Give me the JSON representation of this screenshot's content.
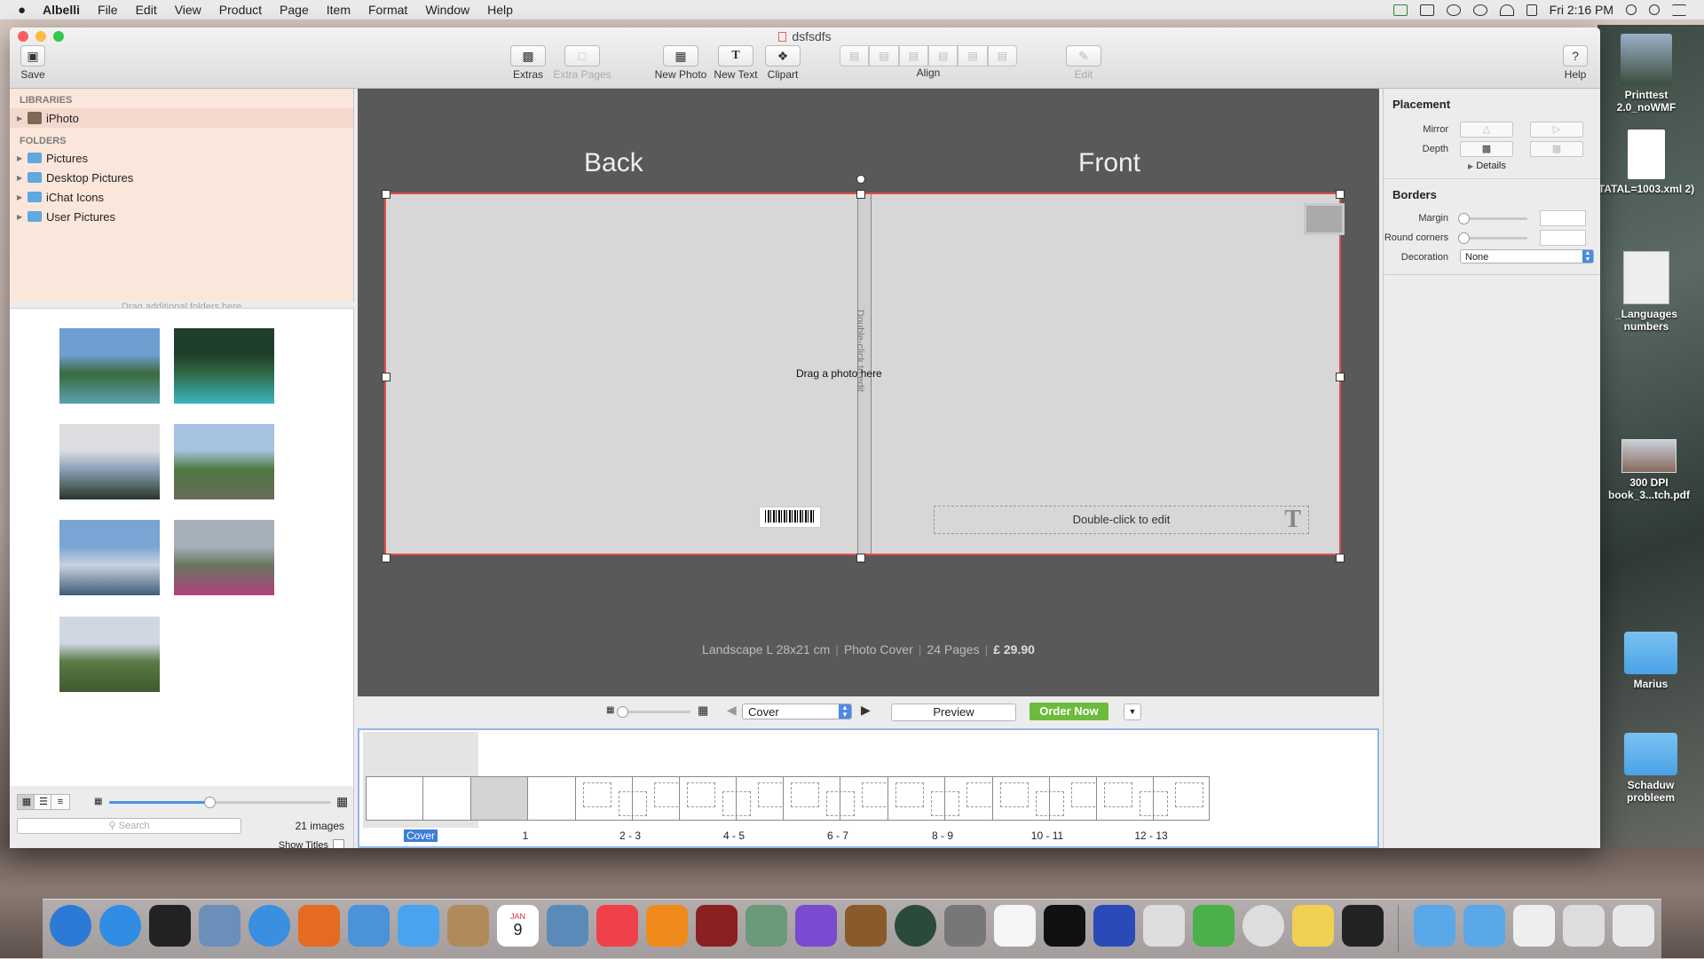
{
  "menubar": {
    "apple": "",
    "app_name": "Albelli",
    "menus": [
      "File",
      "Edit",
      "View",
      "Product",
      "Page",
      "Item",
      "Format",
      "Window",
      "Help"
    ],
    "clock": "Fri 2:16 PM"
  },
  "window": {
    "title": "dsfsdfs",
    "toolbar": {
      "save": "Save",
      "extras": "Extras",
      "extra_pages": "Extra Pages",
      "new_photo": "New Photo",
      "new_text": "New Text",
      "clipart": "Clipart",
      "align": "Align",
      "edit": "Edit",
      "help": "Help"
    }
  },
  "sidebar": {
    "libraries_header": "LIBRARIES",
    "libraries": [
      {
        "label": "iPhoto"
      }
    ],
    "folders_header": "FOLDERS",
    "folders": [
      {
        "label": "Pictures"
      },
      {
        "label": "Desktop Pictures"
      },
      {
        "label": "iChat Icons"
      },
      {
        "label": "User Pictures"
      }
    ],
    "drag_hint": "Drag additional folders here"
  },
  "library": {
    "thumbnails": [
      {
        "name": "mountain-lake",
        "colors": [
          "#6f9fd1",
          "#3a6a3c",
          "#5aa0b0"
        ]
      },
      {
        "name": "pine-forest-lake",
        "colors": [
          "#1f3f2a",
          "#2e6a44",
          "#3ab6c2"
        ]
      },
      {
        "name": "cloudy-shore",
        "colors": [
          "#dcdde0",
          "#8aa0b8",
          "#2a3528"
        ]
      },
      {
        "name": "green-path",
        "colors": [
          "#a7c2e0",
          "#4d7a40",
          "#6a6a5a"
        ]
      },
      {
        "name": "sky-lake",
        "colors": [
          "#7aa4d4",
          "#c7d3df",
          "#3f5c7a"
        ]
      },
      {
        "name": "purple-flowers",
        "colors": [
          "#a5b0ba",
          "#6a7560",
          "#b0407a"
        ]
      },
      {
        "name": "green-valley",
        "colors": [
          "#cfd8e2",
          "#5a7a45",
          "#3f5a30"
        ]
      }
    ],
    "search_placeholder": "Search",
    "image_count": "21 images",
    "show_titles": "Show Titles"
  },
  "canvas": {
    "back_label": "Back",
    "front_label": "Front",
    "drag_photo_hint": "Drag a photo here",
    "spine_hint": "Double-click to edit",
    "text_box_hint": "Double-click to edit",
    "info": {
      "format": "Landscape L 28x21 cm",
      "cover": "Photo Cover",
      "pages": "24 Pages",
      "price": "£ 29.90"
    }
  },
  "controls": {
    "page_select": "Cover",
    "preview": "Preview",
    "order_now": "Order Now"
  },
  "filmstrip": [
    {
      "label": "Cover"
    },
    {
      "label": "1"
    },
    {
      "label": "2 - 3"
    },
    {
      "label": "4 - 5"
    },
    {
      "label": "6 - 7"
    },
    {
      "label": "8 - 9"
    },
    {
      "label": "10 - 11"
    },
    {
      "label": "12 - 13"
    }
  ],
  "inspector": {
    "placement_header": "Placement",
    "mirror": "Mirror",
    "depth": "Depth",
    "details": "Details",
    "borders_header": "Borders",
    "margin": "Margin",
    "round_corners": "Round corners",
    "decoration": "Decoration",
    "decoration_value": "None"
  },
  "desktop": {
    "icons": [
      {
        "label": "Printtest 2.0_noWMF"
      },
      {
        "label": "TATAL=1003.xml 2)"
      },
      {
        "label": "_Languages numbers"
      },
      {
        "label": "300 DPI book_3...tch.pdf"
      },
      {
        "label": "Marius"
      },
      {
        "label": "Schaduw probleem"
      }
    ]
  },
  "dock": {
    "apps": [
      "finder-icon",
      "app-store-icon",
      "launchpad-icon",
      "preview-icon",
      "safari-icon",
      "firefox-icon",
      "mail-icon",
      "messages-icon",
      "contacts-icon",
      "calendar-icon",
      "iphoto-icon",
      "itunes-icon",
      "ibooks-icon",
      "photo-booth-icon",
      "iphoto-palm-icon",
      "imovie-icon",
      "garageband-icon",
      "time-machine-icon",
      "system-preferences-icon",
      "textedit-icon",
      "terminal-icon",
      "instruments-icon",
      "preview-app-icon",
      "numbers-icon",
      "chrome-icon",
      "stickies-icon",
      "albelli-icon"
    ],
    "right": [
      "applications-folder-icon",
      "downloads-folder-icon",
      "document-stack-icon",
      "window-stack-icon",
      "trash-icon"
    ],
    "calendar_day": "9",
    "calendar_month": "JAN"
  }
}
